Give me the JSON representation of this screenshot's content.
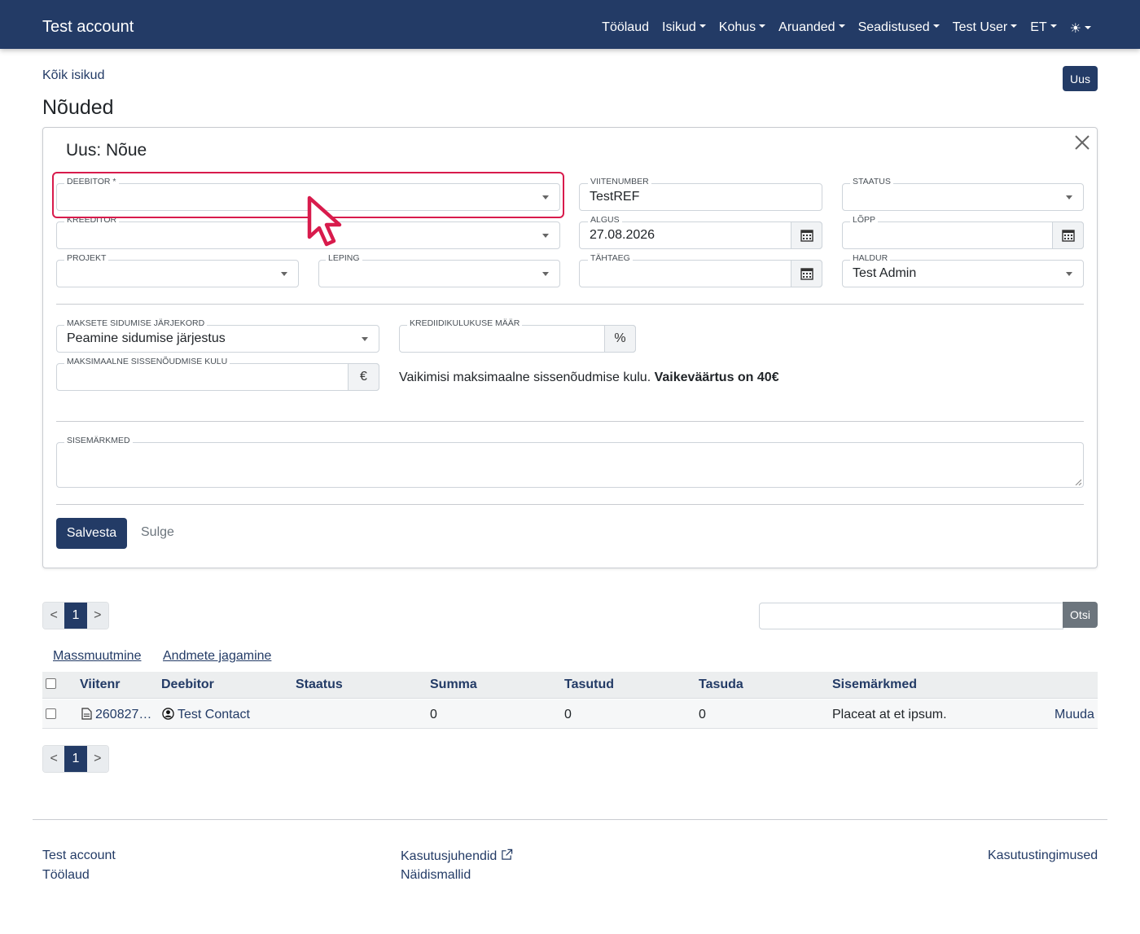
{
  "navbar": {
    "brand": "Test account",
    "items": [
      {
        "label": "Töölaud",
        "dropdown": false
      },
      {
        "label": "Isikud",
        "dropdown": true
      },
      {
        "label": "Kohus",
        "dropdown": true
      },
      {
        "label": "Aruanded",
        "dropdown": true
      },
      {
        "label": "Seadistused",
        "dropdown": true
      },
      {
        "label": "Test User",
        "dropdown": true
      },
      {
        "label": "ET",
        "dropdown": true
      }
    ],
    "theme_icon": "☀"
  },
  "breadcrumb": "Kõik isikud",
  "page_title": "Nõuded",
  "new_button": "Uus",
  "form": {
    "title": "Uus: Nõue",
    "debtor": {
      "label": "DEEBITOR *",
      "value": ""
    },
    "creditor": {
      "label": "KREEDITOR",
      "value": ""
    },
    "project": {
      "label": "PROJEKT",
      "value": ""
    },
    "contract": {
      "label": "LEPING",
      "value": ""
    },
    "reference": {
      "label": "VIITENUMBER",
      "value": "TestREF"
    },
    "start": {
      "label": "ALGUS",
      "value": "27.08.2026"
    },
    "deadline": {
      "label": "TÄHTAEG",
      "value": ""
    },
    "status": {
      "label": "STAATUS",
      "value": ""
    },
    "end": {
      "label": "LÕPP",
      "value": ""
    },
    "manager": {
      "label": "HALDUR",
      "value": "Test Admin"
    },
    "payment_order": {
      "label": "MAKSETE SIDUMISE JÄRJEKORD",
      "value": "Peamine sidumise järjestus"
    },
    "credit_rate": {
      "label": "KREDIIDIKULUKUSE MÄÄR",
      "value": "",
      "unit": "%"
    },
    "max_cost": {
      "label": "MAKSIMAALNE SISSENÕUDMISE KULU",
      "value": "",
      "unit": "€"
    },
    "info_text": "Vaikimisi maksimaalne sissenõudmise kulu.",
    "info_bold": "Vaikeväärtus on 40€",
    "notes": {
      "label": "SISEMÄRKMED",
      "value": ""
    },
    "save_button": "Salvesta",
    "close_button": "Sulge"
  },
  "pagination": {
    "prev": "<",
    "current": "1",
    "next": ">"
  },
  "search": {
    "value": "",
    "button": "Otsi"
  },
  "actions": {
    "mass_edit": "Massmuutmine",
    "data_share": "Andmete jagamine"
  },
  "table": {
    "columns": [
      "Viitenr",
      "Deebitor",
      "Staatus",
      "Summa",
      "Tasutud",
      "Tasuda",
      "Sisemärkmed"
    ],
    "rows": [
      {
        "ref": "260827…",
        "debtor": "Test Contact",
        "status": "",
        "sum": "0",
        "paid": "0",
        "due": "0",
        "notes": "Placeat at et ipsum.",
        "edit": "Muuda"
      }
    ]
  },
  "footer": {
    "col1": [
      "Test account",
      "Töölaud"
    ],
    "col2": [
      "Kasutusjuhendid",
      "Näidismallid"
    ],
    "col3": [
      "Kasutustingimused"
    ]
  },
  "colors": {
    "primary": "#233b66",
    "highlight": "#d81b4c",
    "secondary": "#6c757d"
  }
}
